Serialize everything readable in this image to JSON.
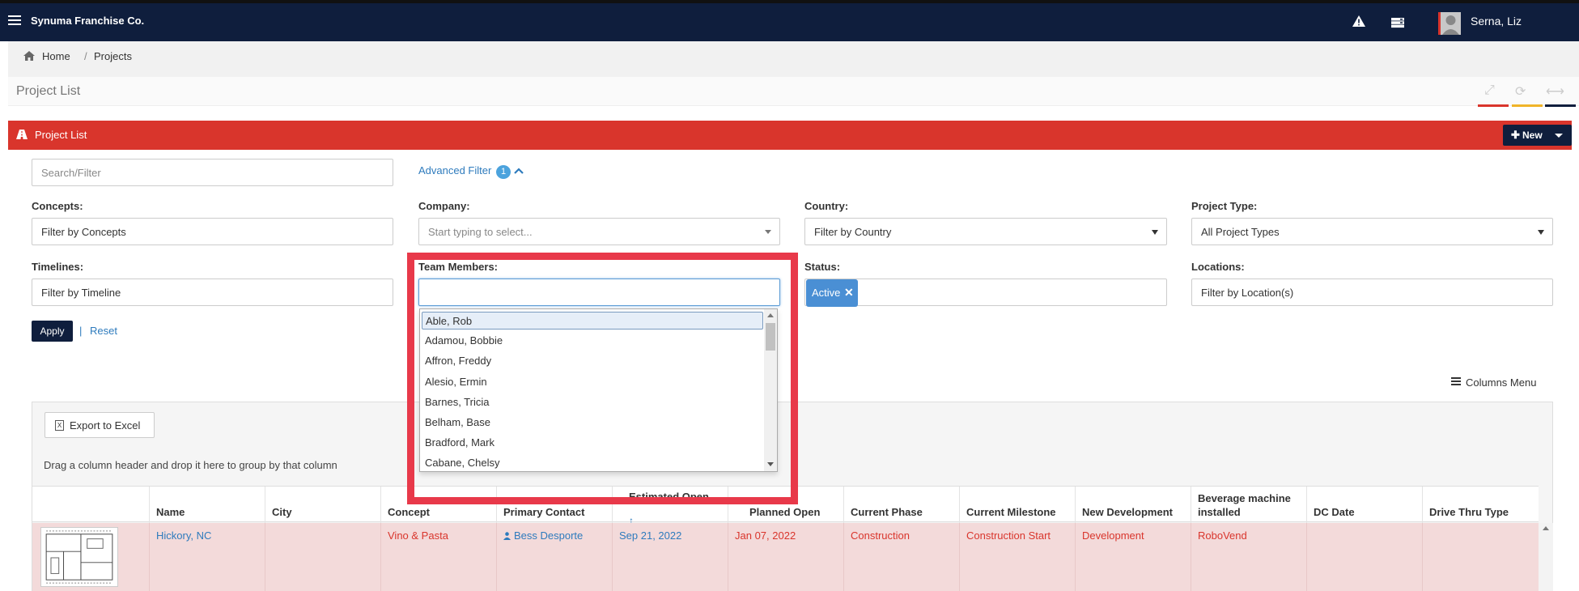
{
  "app": {
    "brand": "Synuma Franchise Co.",
    "user": "Serna, Liz"
  },
  "breadcrumb": {
    "home": "Home",
    "separator": "/",
    "current": "Projects"
  },
  "page": {
    "title": "Project List"
  },
  "colors": {
    "nav": "#0f1e3d",
    "accent": "#d9352c",
    "link": "#2e7bbd",
    "tab_lines": [
      "#d9352c",
      "#f0b429",
      "#0f1e3d"
    ],
    "highlight": "#e8394a"
  },
  "list_header": {
    "title": "Project List",
    "new_label": "New"
  },
  "filters": {
    "search_placeholder": "Search/Filter",
    "advanced_filter": "Advanced Filter",
    "advanced_count": "1",
    "concepts": {
      "label": "Concepts:",
      "placeholder": "Filter by Concepts"
    },
    "company": {
      "label": "Company:",
      "placeholder": "Start typing to select..."
    },
    "country": {
      "label": "Country:",
      "value": "Filter by Country"
    },
    "project_type": {
      "label": "Project Type:",
      "value": "All Project Types"
    },
    "timelines": {
      "label": "Timelines:",
      "placeholder": "Filter by Timeline"
    },
    "team_members": {
      "label": "Team Members:",
      "value": ""
    },
    "status": {
      "label": "Status:",
      "tag": "Active"
    },
    "locations": {
      "label": "Locations:",
      "placeholder": "Filter by Location(s)"
    },
    "apply": "Apply",
    "separator": "|",
    "reset": "Reset"
  },
  "team_member_options": [
    "Able, Rob",
    "Adamou, Bobbie",
    "Affron, Freddy",
    "Alesio, Ermin",
    "Barnes, Tricia",
    "Belham, Base",
    "Bradford, Mark",
    "Cabane, Chelsy"
  ],
  "columns_menu": "Columns Menu",
  "grid": {
    "export": "Export to Excel",
    "group_hint": "Drag a column header and drop it here to group by that column",
    "columns": [
      "",
      "Name",
      "City",
      "Concept",
      "Primary Contact",
      "Estimated Open",
      "Planned Open",
      "Current Phase",
      "Current Milestone",
      "New Development",
      "Beverage machine installed",
      "DC Date",
      "Drive Thru Type"
    ],
    "sort_indicator": "↑",
    "rows": [
      {
        "name": "Hickory, NC",
        "city": "",
        "concept": "Vino & Pasta",
        "primary_contact": "Bess Desporte",
        "estimated_open": "Sep 21, 2022",
        "planned_open": "Jan 07, 2022",
        "current_phase": "Construction",
        "current_milestone": "Construction Start",
        "new_development": "Development",
        "beverage_machine": "RoboVend",
        "dc_date": "",
        "drive_thru_type": ""
      }
    ]
  },
  "icons": [
    "hamburger-icon",
    "warning-icon",
    "server-icon",
    "home-icon",
    "expand-icon",
    "refresh-icon",
    "collapse-icon",
    "road-icon",
    "plus-icon",
    "chevron-up-icon",
    "close-icon",
    "list-icon",
    "excel-icon",
    "user-icon"
  ]
}
